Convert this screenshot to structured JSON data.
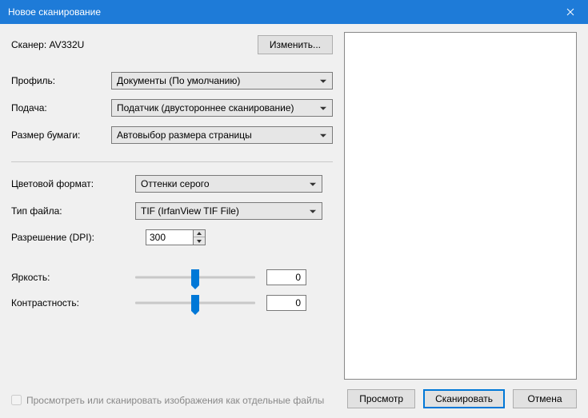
{
  "title": "Новое сканирование",
  "scanner": {
    "label": "Сканер:",
    "value": "AV332U",
    "change_btn": "Изменить..."
  },
  "profile": {
    "label": "Профиль:",
    "value": "Документы (По умолчанию)"
  },
  "feed": {
    "label": "Подача:",
    "value": "Податчик (двустороннее сканирование)"
  },
  "paper": {
    "label": "Размер бумаги:",
    "value": "Автовыбор размера страницы"
  },
  "color": {
    "label": "Цветовой формат:",
    "value": "Оттенки серого"
  },
  "filetype": {
    "label": "Тип файла:",
    "value": "TIF (IrfanView TIF File)"
  },
  "dpi": {
    "label": "Разрешение (DPI):",
    "value": "300"
  },
  "brightness": {
    "label": "Яркость:",
    "value": "0"
  },
  "contrast": {
    "label": "Контрастность:",
    "value": "0"
  },
  "separate": {
    "label": "Просмотреть или сканировать изображения как отдельные файлы"
  },
  "footer": {
    "preview": "Просмотр",
    "scan": "Сканировать",
    "cancel": "Отмена"
  }
}
